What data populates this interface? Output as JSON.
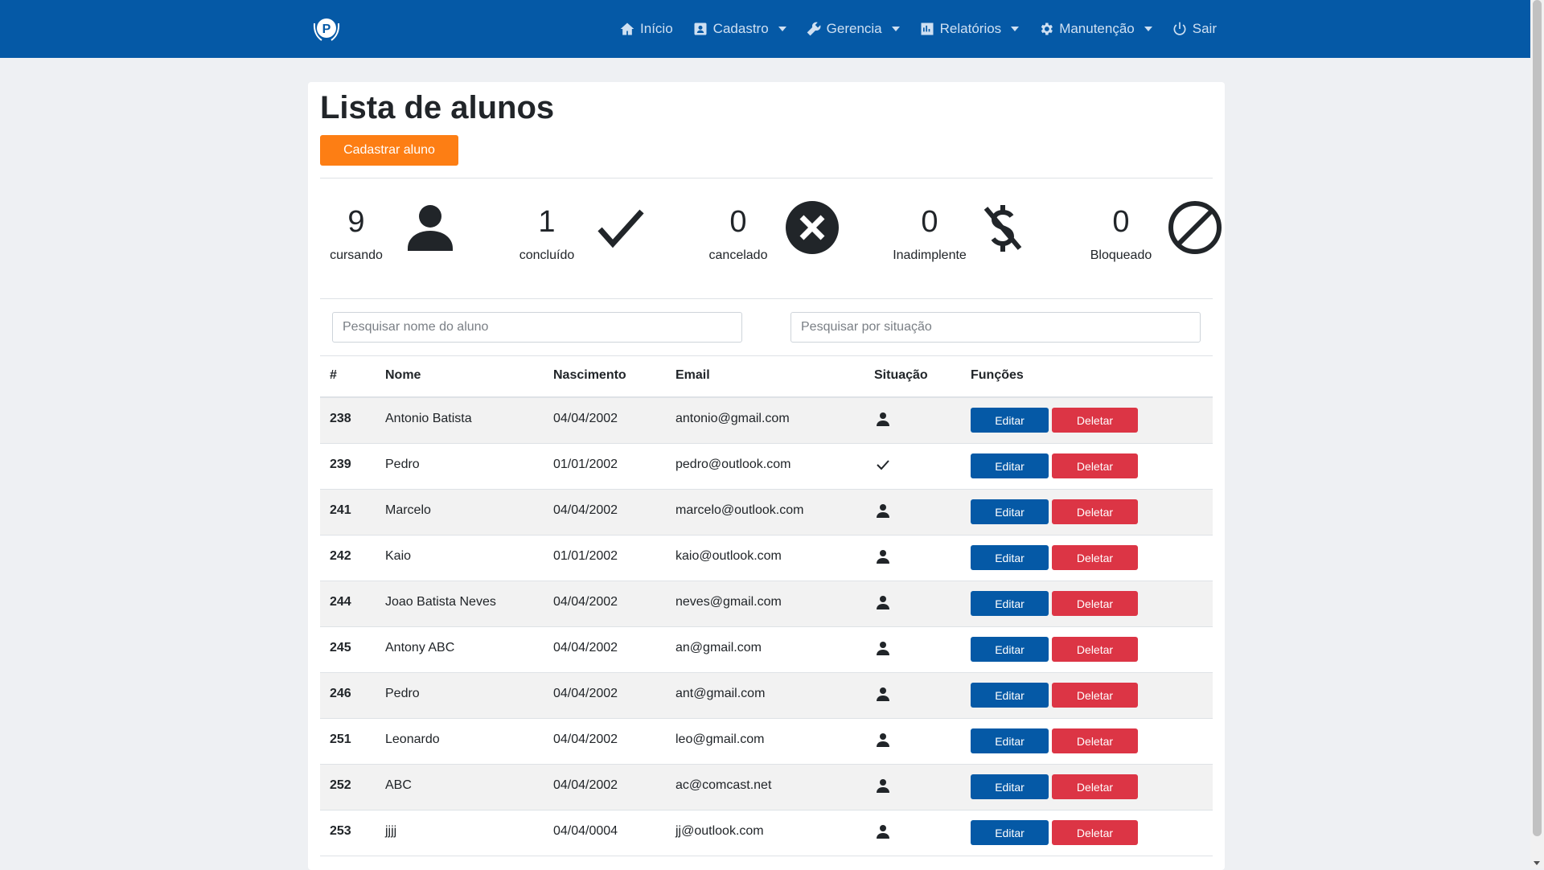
{
  "nav": {
    "items": [
      {
        "label": "Início",
        "icon": "home-icon",
        "dropdown": false
      },
      {
        "label": "Cadastro",
        "icon": "id-card-icon",
        "dropdown": true
      },
      {
        "label": "Gerencia",
        "icon": "wrench-icon",
        "dropdown": true
      },
      {
        "label": "Relatórios",
        "icon": "bar-chart-icon",
        "dropdown": true
      },
      {
        "label": "Manutenção",
        "icon": "gear-icon",
        "dropdown": true
      },
      {
        "label": "Sair",
        "icon": "power-icon",
        "dropdown": false
      }
    ],
    "color": "#0559a6"
  },
  "page": {
    "title": "Lista de alunos",
    "add_button": "Cadastrar aluno"
  },
  "stats": [
    {
      "count": "9",
      "label": "cursando",
      "icon": "user-icon"
    },
    {
      "count": "1",
      "label": "concluído",
      "icon": "check-icon"
    },
    {
      "count": "0",
      "label": "cancelado",
      "icon": "x-circle-icon"
    },
    {
      "count": "0",
      "label": "Inadimplente",
      "icon": "no-dollar-icon"
    },
    {
      "count": "0",
      "label": "Bloqueado",
      "icon": "block-icon"
    }
  ],
  "search": {
    "name_placeholder": "Pesquisar nome do aluno",
    "status_placeholder": "Pesquisar por situação"
  },
  "table": {
    "headers": [
      "#",
      "Nome",
      "Nascimento",
      "Email",
      "Situação",
      "Funções"
    ],
    "edit_label": "Editar",
    "delete_label": "Deletar",
    "rows": [
      {
        "id": "238",
        "nome": "Antonio Batista",
        "nascimento": "04/04/2002",
        "email": "antonio@gmail.com",
        "situacao": "user-icon"
      },
      {
        "id": "239",
        "nome": "Pedro",
        "nascimento": "01/01/2002",
        "email": "pedro@outlook.com",
        "situacao": "check-icon"
      },
      {
        "id": "241",
        "nome": "Marcelo",
        "nascimento": "04/04/2002",
        "email": "marcelo@outlook.com",
        "situacao": "user-icon"
      },
      {
        "id": "242",
        "nome": "Kaio",
        "nascimento": "01/01/2002",
        "email": "kaio@outlook.com",
        "situacao": "user-icon"
      },
      {
        "id": "244",
        "nome": "Joao Batista Neves",
        "nascimento": "04/04/2002",
        "email": "neves@gmail.com",
        "situacao": "user-icon"
      },
      {
        "id": "245",
        "nome": "Antony ABC",
        "nascimento": "04/04/2002",
        "email": "an@gmail.com",
        "situacao": "user-icon"
      },
      {
        "id": "246",
        "nome": "Pedro",
        "nascimento": "04/04/2002",
        "email": "ant@gmail.com",
        "situacao": "user-icon"
      },
      {
        "id": "251",
        "nome": "Leonardo",
        "nascimento": "04/04/2002",
        "email": "leo@gmail.com",
        "situacao": "user-icon"
      },
      {
        "id": "252",
        "nome": "ABC",
        "nascimento": "04/04/2002",
        "email": "ac@comcast.net",
        "situacao": "user-icon"
      },
      {
        "id": "253",
        "nome": "jjjj",
        "nascimento": "04/04/0004",
        "email": "jj@outlook.com",
        "situacao": "user-icon"
      }
    ]
  },
  "colors": {
    "accent": "#fd7e14",
    "edit": "#0559a6",
    "delete": "#dc3545"
  }
}
